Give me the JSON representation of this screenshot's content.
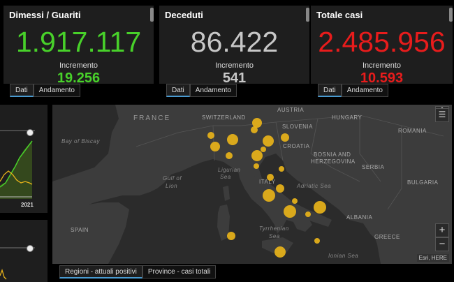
{
  "cards": [
    {
      "title": "Dimessi / Guariti",
      "value": "1.917.117",
      "inc_label": "Incremento",
      "inc": "19.256",
      "color": "#48d12a"
    },
    {
      "title": "Deceduti",
      "value": "86.422",
      "inc_label": "Incremento",
      "inc": "541",
      "color": "#c7c7c7"
    },
    {
      "title": "Totale casi",
      "value": "2.485.956",
      "inc_label": "Incremento",
      "inc": "10.593",
      "color": "#e81c1c"
    }
  ],
  "card_tabs": {
    "dati": "Dati",
    "andamento": "Andamento"
  },
  "mini_chart": {
    "year_label": "2021"
  },
  "map": {
    "labels": {
      "france": "FRANCE",
      "switzerland": "SWITZERLAND",
      "austria": "AUSTRIA",
      "hungary": "HUNGARY",
      "romania": "ROMANIA",
      "slovenia": "SLOVENIA",
      "croatia": "CROATIA",
      "bosnia": "BOSNIA AND",
      "herzegovina": "HERZEGOVINA",
      "serbia": "SERBIA",
      "bulgaria": "BULGARIA",
      "italy": "ITALY",
      "albania": "ALBANIA",
      "greece": "GREECE",
      "spain": "SPAIN",
      "bay_biscay": "Bay of Biscay",
      "gulf_lion": "Gulf of",
      "gulf_lion2": "Lion",
      "ligurian": "Ligurian",
      "ligurian2": "Sea",
      "adriatic": "Adriatic Sea",
      "tyrrhenian": "Tyrrhenian",
      "tyrrhenian2": "Sea",
      "ionian": "Ionian Sea"
    },
    "zoom_in": "+",
    "zoom_out": "−",
    "attribution": "Esri, HERE",
    "tabs": [
      "Regioni - attuali positivi",
      "Province - casi totali"
    ]
  },
  "bubble_color": "#e8b31a"
}
